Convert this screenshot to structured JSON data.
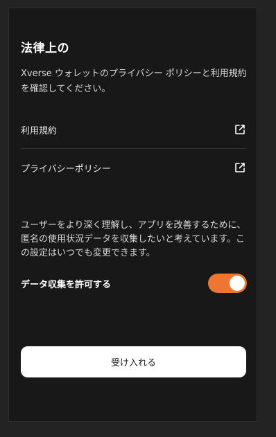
{
  "title": "法律上の",
  "intro": "Xverse ウォレットのプライバシー ポリシーと利用規約を確認してください。",
  "links": [
    {
      "label": "利用規約",
      "icon": "external-link-icon"
    },
    {
      "label": "プライバシーポリシー",
      "icon": "external-link-icon"
    }
  ],
  "analytics": {
    "description": "ユーザーをより深く理解し、アプリを改善するために、匿名の使用状況データを収集したいと考えています。この設定はいつでも変更できます。",
    "toggle_label": "データ収集を許可する",
    "enabled": true
  },
  "accept_label": "受け入れる",
  "colors": {
    "accent": "#ef7630",
    "panel": "#181818",
    "background": "#232323",
    "button": "#ffffff"
  }
}
